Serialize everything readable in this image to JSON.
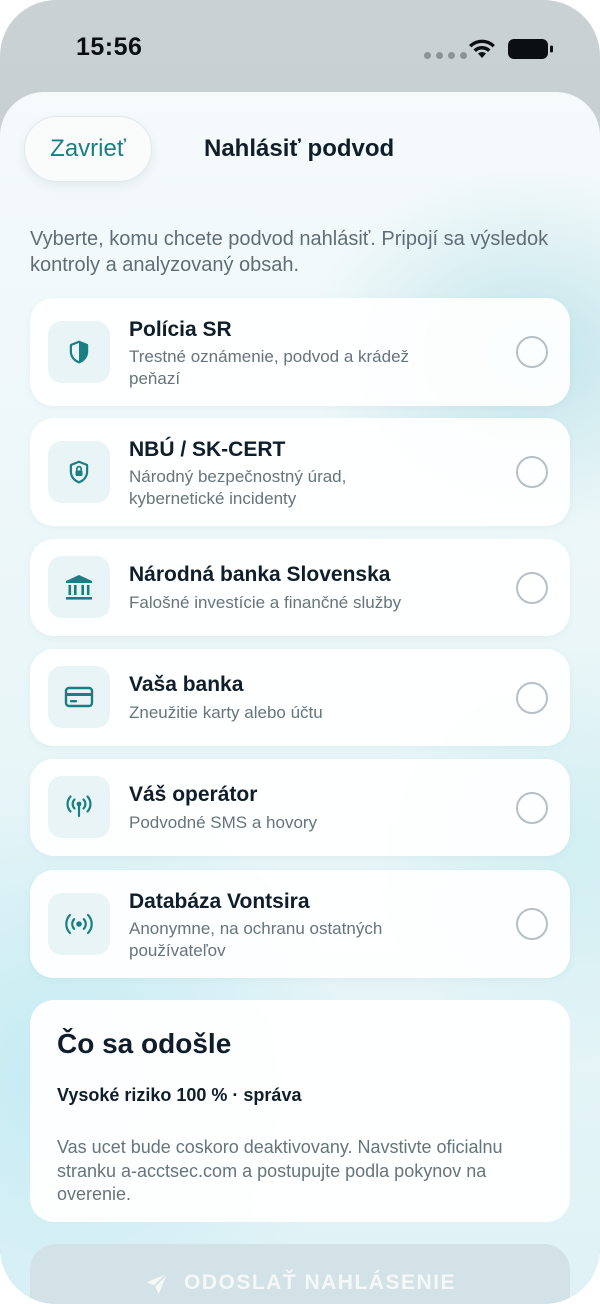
{
  "status_bar": {
    "time": "15:56",
    "icons": [
      "cellular-dots-icon",
      "wifi-icon",
      "battery-icon"
    ]
  },
  "header": {
    "close_label": "Zavrieť",
    "title": "Nahlásiť podvod"
  },
  "intro": "Vyberte, komu chcete podvod nahlásiť. Pripojí sa výsledok kontroly a analyzovaný obsah.",
  "options": [
    {
      "title": "Polícia SR",
      "description": "Trestné oznámenie, podvod a krádež peňazí",
      "icon": "shield-icon",
      "selected": false
    },
    {
      "title": "NBÚ / SK-CERT",
      "description": "Národný bezpečnostný úrad, kybernetické incidenty",
      "icon": "shield-lock-icon",
      "selected": false
    },
    {
      "title": "Národná banka Slovenska",
      "description": "Falošné investície a finančné služby",
      "icon": "bank-icon",
      "selected": false
    },
    {
      "title": "Vaša banka",
      "description": "Zneužitie karty alebo účtu",
      "icon": "credit-card-icon",
      "selected": false
    },
    {
      "title": "Váš operátor",
      "description": "Podvodné SMS a hovory",
      "icon": "antenna-icon",
      "selected": false
    },
    {
      "title": "Databáza Vontsira",
      "description": "Anonymne, na ochranu ostatných používateľov",
      "icon": "broadcast-icon",
      "selected": false
    }
  ],
  "summary": {
    "title": "Čo sa odošle",
    "risk_line": "Vysoké riziko 100 % · správa",
    "message": "Vas ucet bude coskoro deaktivovany. Navstivte oficialnu stranku a-acctsec.com a postupujte podla pokynov na overenie."
  },
  "submit": {
    "label": "ODOSLAŤ NAHLÁSENIE",
    "icon": "send-icon",
    "enabled": false
  },
  "colors": {
    "accent": "#1a7f82",
    "icon_background": "#e8f4f6",
    "disabled_button": "#d3e2e6"
  }
}
